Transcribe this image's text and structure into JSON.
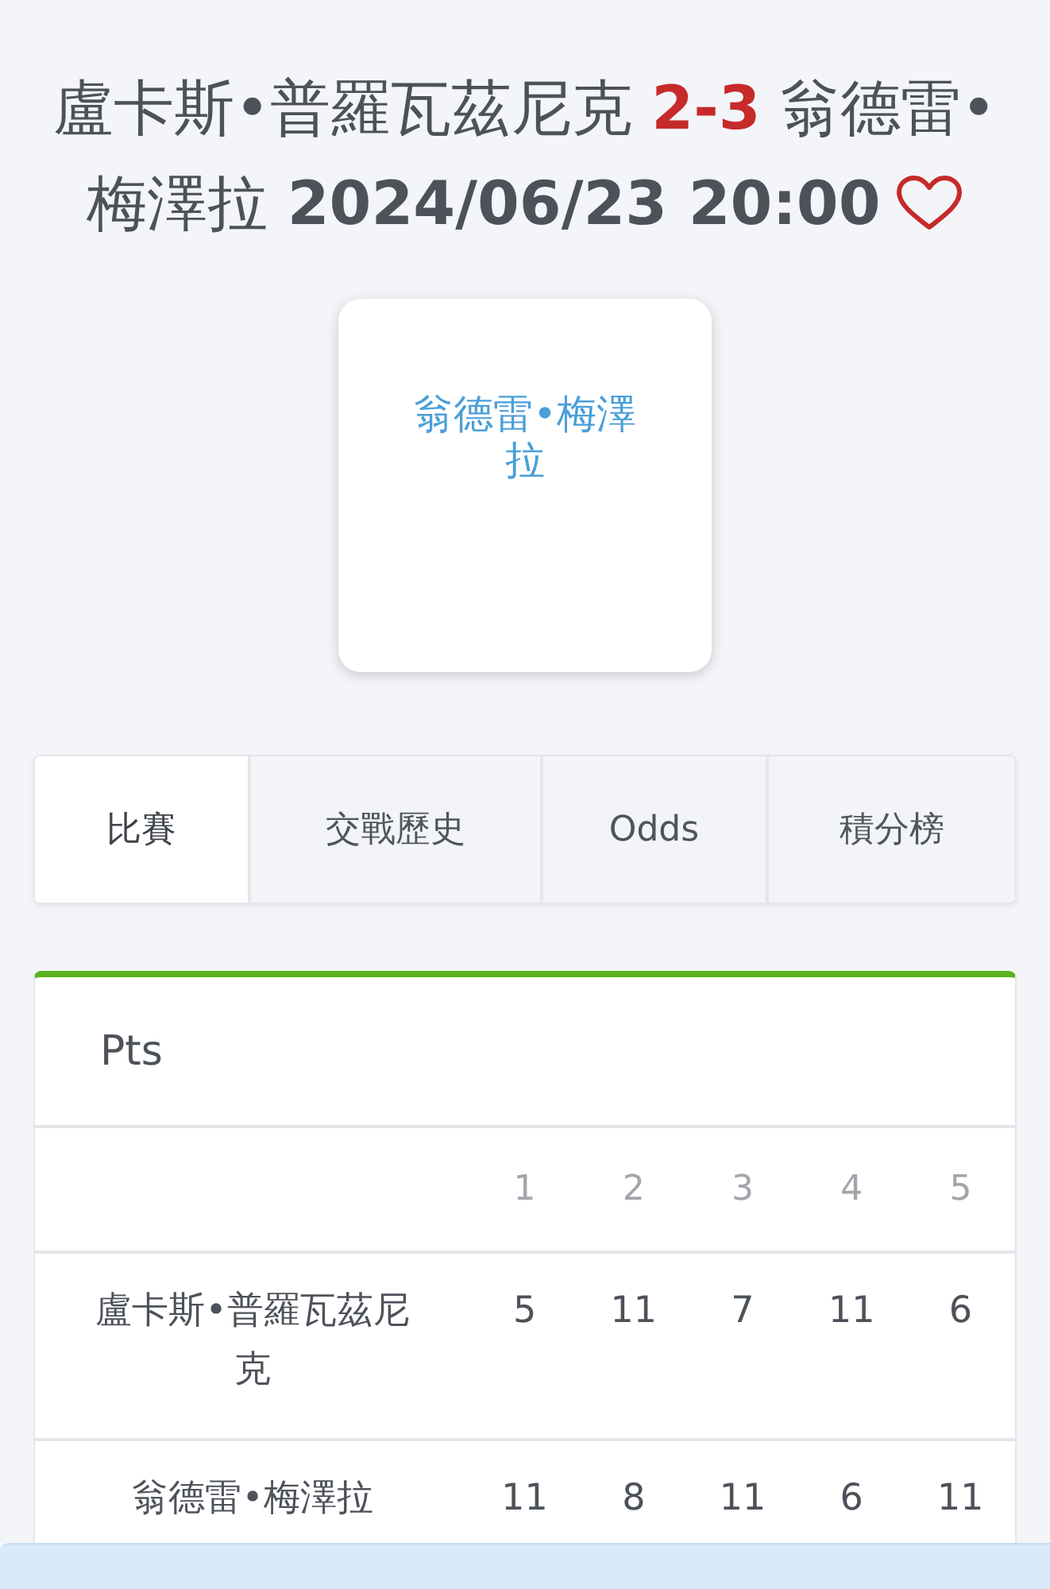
{
  "header": {
    "title_lines": [
      "盧卡斯•普羅瓦茲尼克 **2-3** 翁德雷•",
      "梅澤拉 **2024/06/23 20:00**"
    ],
    "favorited": false
  },
  "team_card": {
    "label": "翁德雷•梅澤拉"
  },
  "tabs": [
    {
      "label": "比賽",
      "selected": true
    },
    {
      "label": "交戰歷史",
      "selected": false
    },
    {
      "label": "Odds",
      "selected": false
    },
    {
      "label": "積分榜",
      "selected": false
    }
  ],
  "score_table": {
    "title": "Pts",
    "columns": [
      "1",
      "2",
      "3",
      "4",
      "5"
    ],
    "rows": [
      {
        "player": "盧卡斯•普羅瓦茲尼克",
        "scores": [
          "5",
          "11",
          "7",
          "11",
          "6"
        ]
      },
      {
        "player": "翁德雷•梅澤拉",
        "scores": [
          "11",
          "8",
          "11",
          "6",
          "11"
        ]
      }
    ]
  }
}
